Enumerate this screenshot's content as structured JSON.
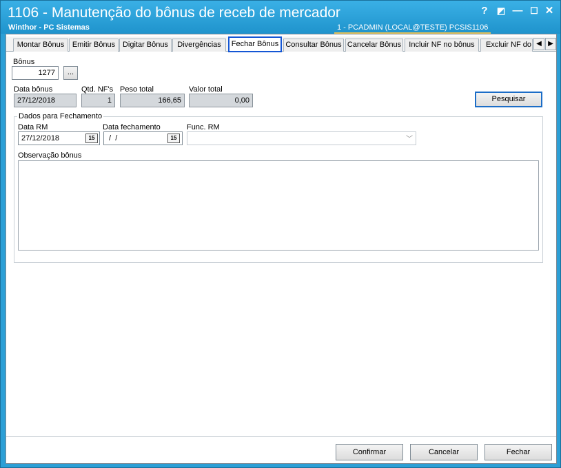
{
  "window": {
    "title": "1106 - Manutenção do bônus de receb de mercador",
    "subtitle": "Winthor - PC Sistemas",
    "user_info": "1 - PCADMIN (LOCAL@TESTE)   PCSIS1106",
    "help_label": "?",
    "restore_label": "◩",
    "minimize_label": "—",
    "maximize_label": "☐",
    "close_label": "✕"
  },
  "tabs": [
    {
      "label": "Montar Bônus"
    },
    {
      "label": "Emitir Bônus"
    },
    {
      "label": "Digitar Bônus"
    },
    {
      "label": "Divergências"
    },
    {
      "label": "Fechar Bônus"
    },
    {
      "label": "Consultar Bônus"
    },
    {
      "label": "Cancelar Bônus"
    },
    {
      "label": "Incluir NF no bônus"
    },
    {
      "label": "Excluir NF do b"
    }
  ],
  "tab_scroll": {
    "left": "◀",
    "right": "▶"
  },
  "form": {
    "bonus_label": "Bônus",
    "bonus_value": "1277",
    "browse_label": "...",
    "data_bonus_label": "Data bônus",
    "data_bonus_value": "27/12/2018",
    "qtd_nfs_label": "Qtd. NF's",
    "qtd_nfs_value": "1",
    "peso_total_label": "Peso total",
    "peso_total_value": "166,65",
    "valor_total_label": "Valor total",
    "valor_total_value": "0,00",
    "pesquisar_label": "Pesquisar"
  },
  "fechamento": {
    "group_title": "Dados para Fechamento",
    "data_rm_label": "Data RM",
    "data_rm_value": "27/12/2018",
    "data_fechamento_label": "Data fechamento",
    "data_fechamento_value": " /  /",
    "func_rm_label": "Func. RM",
    "func_rm_value": "",
    "calendar_glyph": "15",
    "dropdown_glyph": "﹀",
    "observacao_label": "Observação bônus",
    "observacao_value": ""
  },
  "footer": {
    "confirmar_label": "Confirmar",
    "cancelar_label": "Cancelar",
    "fechar_label": "Fechar"
  }
}
